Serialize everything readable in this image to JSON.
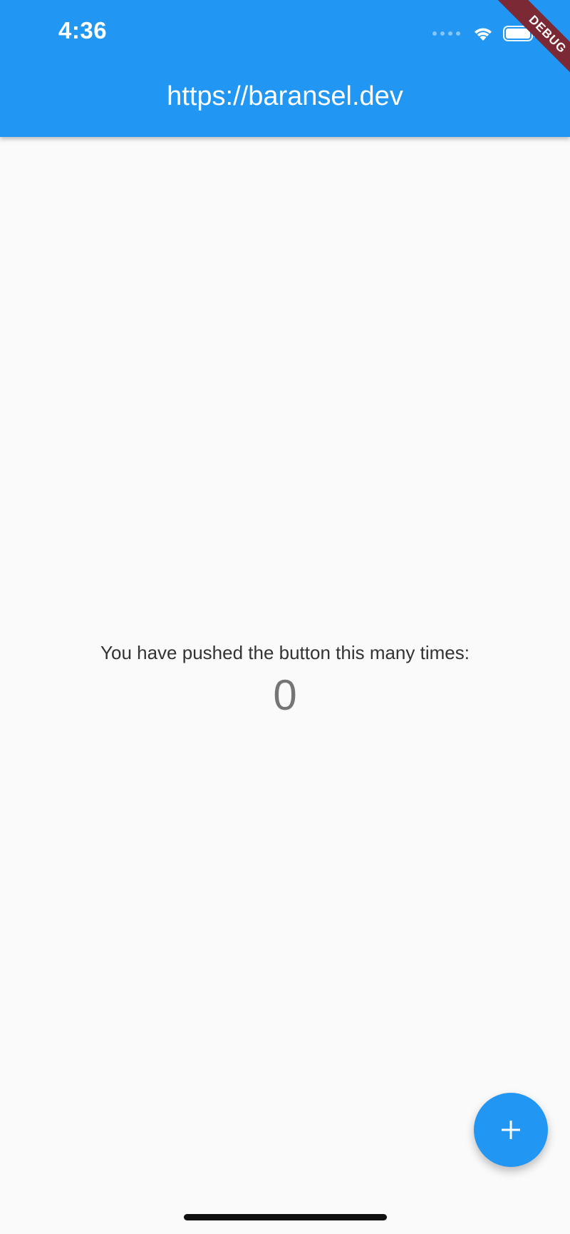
{
  "status_bar": {
    "time": "4:36",
    "icons": [
      "cellular-signal-icon",
      "wifi-icon",
      "battery-icon"
    ]
  },
  "app_bar": {
    "title": "https://baransel.dev",
    "color": "#2196f3"
  },
  "debug_banner": {
    "label": "DEBUG",
    "color": "#7a2935"
  },
  "main": {
    "counter_label": "You have pushed the button this many times:",
    "counter_value": "0"
  },
  "fab": {
    "icon": "plus-icon",
    "color": "#2196f3"
  }
}
